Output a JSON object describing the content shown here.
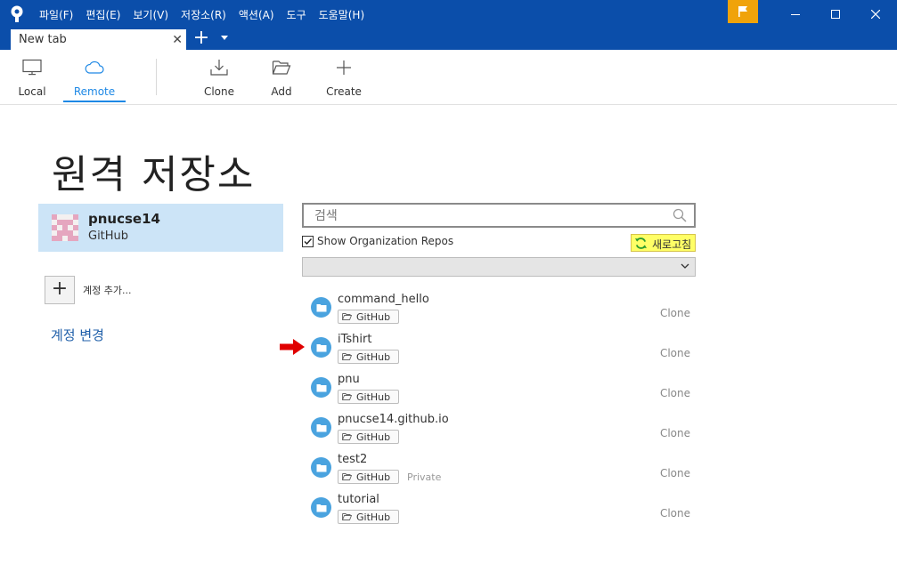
{
  "menu": [
    "파일(F)",
    "편집(E)",
    "보기(V)",
    "저장소(R)",
    "액션(A)",
    "도구",
    "도움말(H)"
  ],
  "tab": {
    "label": "New tab"
  },
  "toolbar": {
    "local": "Local",
    "remote": "Remote",
    "clone": "Clone",
    "add": "Add",
    "create": "Create",
    "active": "remote"
  },
  "page": {
    "title": "원격 저장소"
  },
  "account": {
    "username": "pnucse14",
    "host": "GitHub",
    "add_label": "계정 추가...",
    "change_label": "계정 변경"
  },
  "search": {
    "placeholder": "검색",
    "value": ""
  },
  "org_repos": {
    "label": "Show Organization Repos",
    "checked": true
  },
  "refresh": {
    "label": "새로고침"
  },
  "org_select": {
    "value": ""
  },
  "repos": [
    {
      "name": "command_hello",
      "host": "GitHub",
      "private": "",
      "action": "Clone"
    },
    {
      "name": "iTshirt",
      "host": "GitHub",
      "private": "",
      "action": "Clone"
    },
    {
      "name": "pnu",
      "host": "GitHub",
      "private": "",
      "action": "Clone"
    },
    {
      "name": "pnucse14.github.io",
      "host": "GitHub",
      "private": "",
      "action": "Clone"
    },
    {
      "name": "test2",
      "host": "GitHub",
      "private": "Private",
      "action": "Clone"
    },
    {
      "name": "tutorial",
      "host": "GitHub",
      "private": "",
      "action": "Clone"
    }
  ],
  "colors": {
    "titlebar": "#0b4eaa",
    "accent": "#1e88e5",
    "account_selected": "#cce4f7",
    "repo_icon": "#4aa3df",
    "refresh_highlight": "#ffff66",
    "flag": "#f0a30a",
    "arrow": "#e00000"
  },
  "icons": {
    "app": "sourcetree-logo-icon",
    "flag": "flag-icon",
    "local": "monitor-icon",
    "remote": "cloud-icon",
    "clone": "download-icon",
    "add": "folder-open-icon",
    "create": "plus-icon",
    "search": "search-icon",
    "refresh": "refresh-icon",
    "repo": "folder-icon",
    "pointer": "red-arrow-icon"
  }
}
